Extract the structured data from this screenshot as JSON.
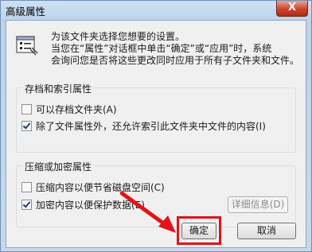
{
  "window": {
    "title": "高级属性",
    "close_glyph": "X"
  },
  "description": {
    "line1": "为该文件夹选择您想要的设置。",
    "line2": "当您在“属性”对话框中单击“确定”或“应用”时，系统",
    "line3": "会询问您是否将这些更改同时应用于所有子文件夹和文件。"
  },
  "archive_group": {
    "title": "存档和索引属性",
    "archive": {
      "label": "可以存档文件夹(A)",
      "checked": false
    },
    "index": {
      "label": "除了文件属性外，还允许索引此文件夹中文件的内容(I)",
      "checked": true
    }
  },
  "compress_group": {
    "title": "压缩或加密属性",
    "compress": {
      "label": "压缩内容以便节省磁盘空间(C)",
      "checked": false
    },
    "encrypt": {
      "label": "加密内容以便保护数据(E)",
      "checked": true
    },
    "details_label": "详细信息(D)"
  },
  "buttons": {
    "ok_label": "确定",
    "cancel_label": "取消"
  },
  "colors": {
    "highlight": "#e0141a"
  }
}
